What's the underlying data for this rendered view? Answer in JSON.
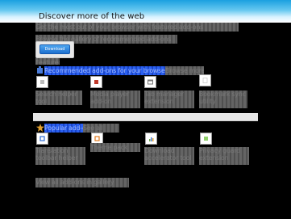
{
  "page": {
    "title": "Discover more of the web"
  },
  "intro": {
    "line1": "Get the most out of your browser with featured add-ons",
    "line2": "Browse the gallery of recommended add-ons"
  },
  "download_button": {
    "label": "Download"
  },
  "section_small": {
    "label": "Featured"
  },
  "section1": {
    "title": "Recommended add-ons for your browser",
    "title_suffix": "Browse more",
    "tiles": [
      {
        "icon": "page-icon",
        "label": "Search helper tool"
      },
      {
        "icon": "red-square-icon",
        "label": "Media player add-on"
      },
      {
        "icon": "window-icon",
        "label": "Tab manager extension"
      },
      {
        "icon": "blank-page-icon",
        "label": "Bookmark sync utility"
      }
    ]
  },
  "section2": {
    "title": "Popular add-ons",
    "title_suffix": "See all",
    "tiles": [
      {
        "icon": "blue-page-icon",
        "label": "Translation toolbar helper"
      },
      {
        "icon": "orange-page-icon",
        "label": "Theme pack"
      },
      {
        "icon": "chart-icon",
        "label": "Download accelerator tool"
      },
      {
        "icon": "green-page-icon",
        "label": "Privacy guard extension"
      }
    ]
  },
  "footer": {
    "link": "View all add-ons in gallery"
  },
  "colors": {
    "header_top": "#1aa0e0",
    "link_blue": "#1e50e0",
    "button_blue": "#1c6fcf",
    "background": "#000000"
  }
}
